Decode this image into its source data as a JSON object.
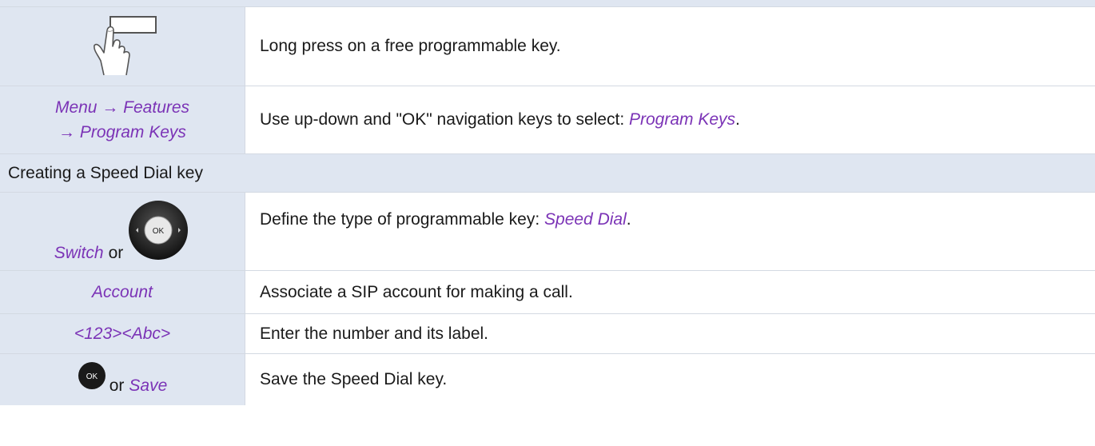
{
  "rows": [
    {
      "left_icon": "hand-press-key-icon",
      "description": "Long press on a free programmable key."
    },
    {
      "left": {
        "line1_part1": "Menu",
        "arrow1": "→",
        "line1_part2": "Features",
        "arrow2": "→",
        "line2": "Program Keys"
      },
      "description": "Use up-down and \"OK\" navigation keys to select: ",
      "description_em": "Program Keys",
      "description_end": "."
    }
  ],
  "section_title": "Creating a Speed Dial key",
  "steps": [
    {
      "left_em": "Switch",
      "left_connector": "or",
      "left_icon": "navigation-pad-icon",
      "icon_label": "OK",
      "description": "Define the type of programmable key: ",
      "description_em": "Speed Dial",
      "description_end": "."
    },
    {
      "left_em": "Account",
      "description": "Associate a SIP account for making a call."
    },
    {
      "left_em": "<123><Abc>",
      "description": "Enter the number and its label."
    },
    {
      "left_icon": "ok-button-icon",
      "icon_label": "OK",
      "left_connector": "or",
      "left_em": "Save",
      "description": "Save the Speed Dial key."
    }
  ],
  "colors": {
    "accent_text": "#7b33b6",
    "cell_background": "#dfe6f1",
    "border": "#d3d9e2"
  }
}
